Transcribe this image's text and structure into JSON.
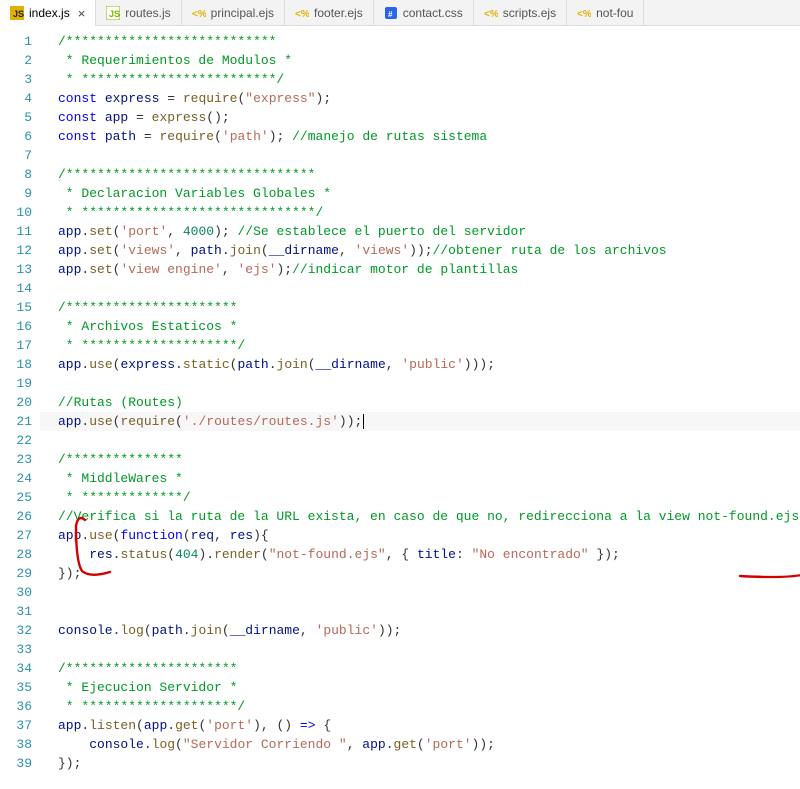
{
  "tabs": [
    {
      "label": "index.js",
      "icon": "js",
      "icon_color": "#e2b100",
      "active": true,
      "close": true
    },
    {
      "label": "routes.js",
      "icon": "js-alt",
      "icon_color": "#7db700",
      "active": false,
      "close": false
    },
    {
      "label": "principal.ejs",
      "icon": "ejs",
      "icon_color": "#e2b100",
      "active": false,
      "close": false
    },
    {
      "label": "footer.ejs",
      "icon": "ejs",
      "icon_color": "#e2b100",
      "active": false,
      "close": false
    },
    {
      "label": "contact.css",
      "icon": "css",
      "icon_color": "#2965f1",
      "active": false,
      "close": false
    },
    {
      "label": "scripts.ejs",
      "icon": "ejs",
      "icon_color": "#e2b100",
      "active": false,
      "close": false
    },
    {
      "label": "not-fou",
      "icon": "ejs",
      "icon_color": "#e2b100",
      "active": false,
      "close": false,
      "truncated": true
    }
  ],
  "close_glyph": "×",
  "cursor_line": 21,
  "annotation_color": "#d40000",
  "code_lines": [
    {
      "n": 1,
      "t": "/***************************",
      "cls": "cmt"
    },
    {
      "n": 2,
      "t": " * Requerimientos de Modulos *",
      "cls": "cmt"
    },
    {
      "n": 3,
      "t": " * *************************/",
      "cls": "cmt"
    },
    {
      "n": 4,
      "tokens": [
        [
          "kw",
          "const"
        ],
        [
          "sp",
          " "
        ],
        [
          "id",
          "express"
        ],
        [
          "sp",
          " "
        ],
        [
          "p",
          "="
        ],
        [
          "sp",
          " "
        ],
        [
          "fn",
          "require"
        ],
        [
          "p",
          "("
        ],
        [
          "str",
          "\"express\""
        ],
        [
          "p",
          ");"
        ]
      ]
    },
    {
      "n": 5,
      "tokens": [
        [
          "kw",
          "const"
        ],
        [
          "sp",
          " "
        ],
        [
          "id",
          "app"
        ],
        [
          "sp",
          " "
        ],
        [
          "p",
          "="
        ],
        [
          "sp",
          " "
        ],
        [
          "fn",
          "express"
        ],
        [
          "p",
          "();"
        ]
      ]
    },
    {
      "n": 6,
      "tokens": [
        [
          "kw",
          "const"
        ],
        [
          "sp",
          " "
        ],
        [
          "id",
          "path"
        ],
        [
          "sp",
          " "
        ],
        [
          "p",
          "="
        ],
        [
          "sp",
          " "
        ],
        [
          "fn",
          "require"
        ],
        [
          "p",
          "("
        ],
        [
          "str",
          "'path'"
        ],
        [
          "p",
          "); "
        ],
        [
          "cmt",
          "//manejo de rutas sistema"
        ]
      ]
    },
    {
      "n": 7,
      "t": "",
      "cls": ""
    },
    {
      "n": 8,
      "t": "/********************************",
      "cls": "cmt"
    },
    {
      "n": 9,
      "t": " * Declaracion Variables Globales *",
      "cls": "cmt"
    },
    {
      "n": 10,
      "t": " * ******************************/",
      "cls": "cmt"
    },
    {
      "n": 11,
      "tokens": [
        [
          "id",
          "app"
        ],
        [
          "p",
          "."
        ],
        [
          "fn",
          "set"
        ],
        [
          "p",
          "("
        ],
        [
          "str",
          "'port'"
        ],
        [
          "p",
          ", "
        ],
        [
          "num",
          "4000"
        ],
        [
          "p",
          "); "
        ],
        [
          "cmt",
          "//Se establece el puerto del servidor"
        ]
      ]
    },
    {
      "n": 12,
      "tokens": [
        [
          "id",
          "app"
        ],
        [
          "p",
          "."
        ],
        [
          "fn",
          "set"
        ],
        [
          "p",
          "("
        ],
        [
          "str",
          "'views'"
        ],
        [
          "p",
          ", "
        ],
        [
          "id",
          "path"
        ],
        [
          "p",
          "."
        ],
        [
          "fn",
          "join"
        ],
        [
          "p",
          "("
        ],
        [
          "id",
          "__dirname"
        ],
        [
          "p",
          ", "
        ],
        [
          "str",
          "'views'"
        ],
        [
          "p",
          "));"
        ],
        [
          "cmt",
          "//obtener ruta de los archivos"
        ]
      ]
    },
    {
      "n": 13,
      "tokens": [
        [
          "id",
          "app"
        ],
        [
          "p",
          "."
        ],
        [
          "fn",
          "set"
        ],
        [
          "p",
          "("
        ],
        [
          "str",
          "'view engine'"
        ],
        [
          "p",
          ", "
        ],
        [
          "str",
          "'ejs'"
        ],
        [
          "p",
          ");"
        ],
        [
          "cmt",
          "//indicar motor de plantillas"
        ]
      ]
    },
    {
      "n": 14,
      "t": "",
      "cls": ""
    },
    {
      "n": 15,
      "t": "/**********************",
      "cls": "cmt"
    },
    {
      "n": 16,
      "t": " * Archivos Estaticos *",
      "cls": "cmt"
    },
    {
      "n": 17,
      "t": " * ********************/",
      "cls": "cmt"
    },
    {
      "n": 18,
      "tokens": [
        [
          "id",
          "app"
        ],
        [
          "p",
          "."
        ],
        [
          "fn",
          "use"
        ],
        [
          "p",
          "("
        ],
        [
          "id",
          "express"
        ],
        [
          "p",
          "."
        ],
        [
          "fn",
          "static"
        ],
        [
          "p",
          "("
        ],
        [
          "id",
          "path"
        ],
        [
          "p",
          "."
        ],
        [
          "fn",
          "join"
        ],
        [
          "p",
          "("
        ],
        [
          "id",
          "__dirname"
        ],
        [
          "p",
          ", "
        ],
        [
          "str",
          "'public'"
        ],
        [
          "p",
          ")));"
        ]
      ]
    },
    {
      "n": 19,
      "t": "",
      "cls": ""
    },
    {
      "n": 20,
      "t": "//Rutas (Routes)",
      "cls": "cmt"
    },
    {
      "n": 21,
      "tokens": [
        [
          "id",
          "app"
        ],
        [
          "p",
          "."
        ],
        [
          "fn",
          "use"
        ],
        [
          "p",
          "("
        ],
        [
          "fn",
          "require"
        ],
        [
          "p",
          "("
        ],
        [
          "str",
          "'./routes/routes.js'"
        ],
        [
          "p",
          "));"
        ]
      ],
      "cursor": true
    },
    {
      "n": 22,
      "t": "",
      "cls": ""
    },
    {
      "n": 23,
      "t": "/***************",
      "cls": "cmt"
    },
    {
      "n": 24,
      "t": " * MiddleWares *",
      "cls": "cmt"
    },
    {
      "n": 25,
      "t": " * *************/",
      "cls": "cmt"
    },
    {
      "n": 26,
      "t": "//Verifica si la ruta de la URL exista, en caso de que no, redirecciona a la view not-found.ejs",
      "cls": "cmt"
    },
    {
      "n": 27,
      "tokens": [
        [
          "id",
          "app"
        ],
        [
          "p",
          "."
        ],
        [
          "fn",
          "use"
        ],
        [
          "p",
          "("
        ],
        [
          "kw",
          "function"
        ],
        [
          "p",
          "("
        ],
        [
          "id",
          "req"
        ],
        [
          "p",
          ", "
        ],
        [
          "id",
          "res"
        ],
        [
          "p",
          "){"
        ]
      ]
    },
    {
      "n": 28,
      "tokens": [
        [
          "sp",
          "    "
        ],
        [
          "id",
          "res"
        ],
        [
          "p",
          "."
        ],
        [
          "fn",
          "status"
        ],
        [
          "p",
          "("
        ],
        [
          "num",
          "404"
        ],
        [
          "p",
          ")."
        ],
        [
          "fn",
          "render"
        ],
        [
          "p",
          "("
        ],
        [
          "str",
          "\"not-found.ejs\""
        ],
        [
          "p",
          ", { "
        ],
        [
          "id",
          "title"
        ],
        [
          "p",
          ": "
        ],
        [
          "str",
          "\"No encontrado\""
        ],
        [
          "p",
          " });"
        ]
      ]
    },
    {
      "n": 29,
      "tokens": [
        [
          "p",
          "});"
        ]
      ]
    },
    {
      "n": 30,
      "t": "",
      "cls": ""
    },
    {
      "n": 31,
      "t": "",
      "cls": ""
    },
    {
      "n": 32,
      "tokens": [
        [
          "id",
          "console"
        ],
        [
          "p",
          "."
        ],
        [
          "fn",
          "log"
        ],
        [
          "p",
          "("
        ],
        [
          "id",
          "path"
        ],
        [
          "p",
          "."
        ],
        [
          "fn",
          "join"
        ],
        [
          "p",
          "("
        ],
        [
          "id",
          "__dirname"
        ],
        [
          "p",
          ", "
        ],
        [
          "str",
          "'public'"
        ],
        [
          "p",
          "));"
        ]
      ]
    },
    {
      "n": 33,
      "t": "",
      "cls": ""
    },
    {
      "n": 34,
      "t": "/**********************",
      "cls": "cmt"
    },
    {
      "n": 35,
      "t": " * Ejecucion Servidor *",
      "cls": "cmt"
    },
    {
      "n": 36,
      "t": " * ********************/",
      "cls": "cmt"
    },
    {
      "n": 37,
      "tokens": [
        [
          "id",
          "app"
        ],
        [
          "p",
          "."
        ],
        [
          "fn",
          "listen"
        ],
        [
          "p",
          "("
        ],
        [
          "id",
          "app"
        ],
        [
          "p",
          "."
        ],
        [
          "fn",
          "get"
        ],
        [
          "p",
          "("
        ],
        [
          "str",
          "'port'"
        ],
        [
          "p",
          "), () "
        ],
        [
          "kw",
          "=>"
        ],
        [
          "p",
          " {"
        ]
      ]
    },
    {
      "n": 38,
      "tokens": [
        [
          "sp",
          "    "
        ],
        [
          "id",
          "console"
        ],
        [
          "p",
          "."
        ],
        [
          "fn",
          "log"
        ],
        [
          "p",
          "("
        ],
        [
          "str",
          "\"Servidor Corriendo \""
        ],
        [
          "p",
          ", "
        ],
        [
          "id",
          "app"
        ],
        [
          "p",
          "."
        ],
        [
          "fn",
          "get"
        ],
        [
          "p",
          "("
        ],
        [
          "str",
          "'port'"
        ],
        [
          "p",
          "));"
        ]
      ]
    },
    {
      "n": 39,
      "tokens": [
        [
          "p",
          "});"
        ]
      ]
    }
  ]
}
